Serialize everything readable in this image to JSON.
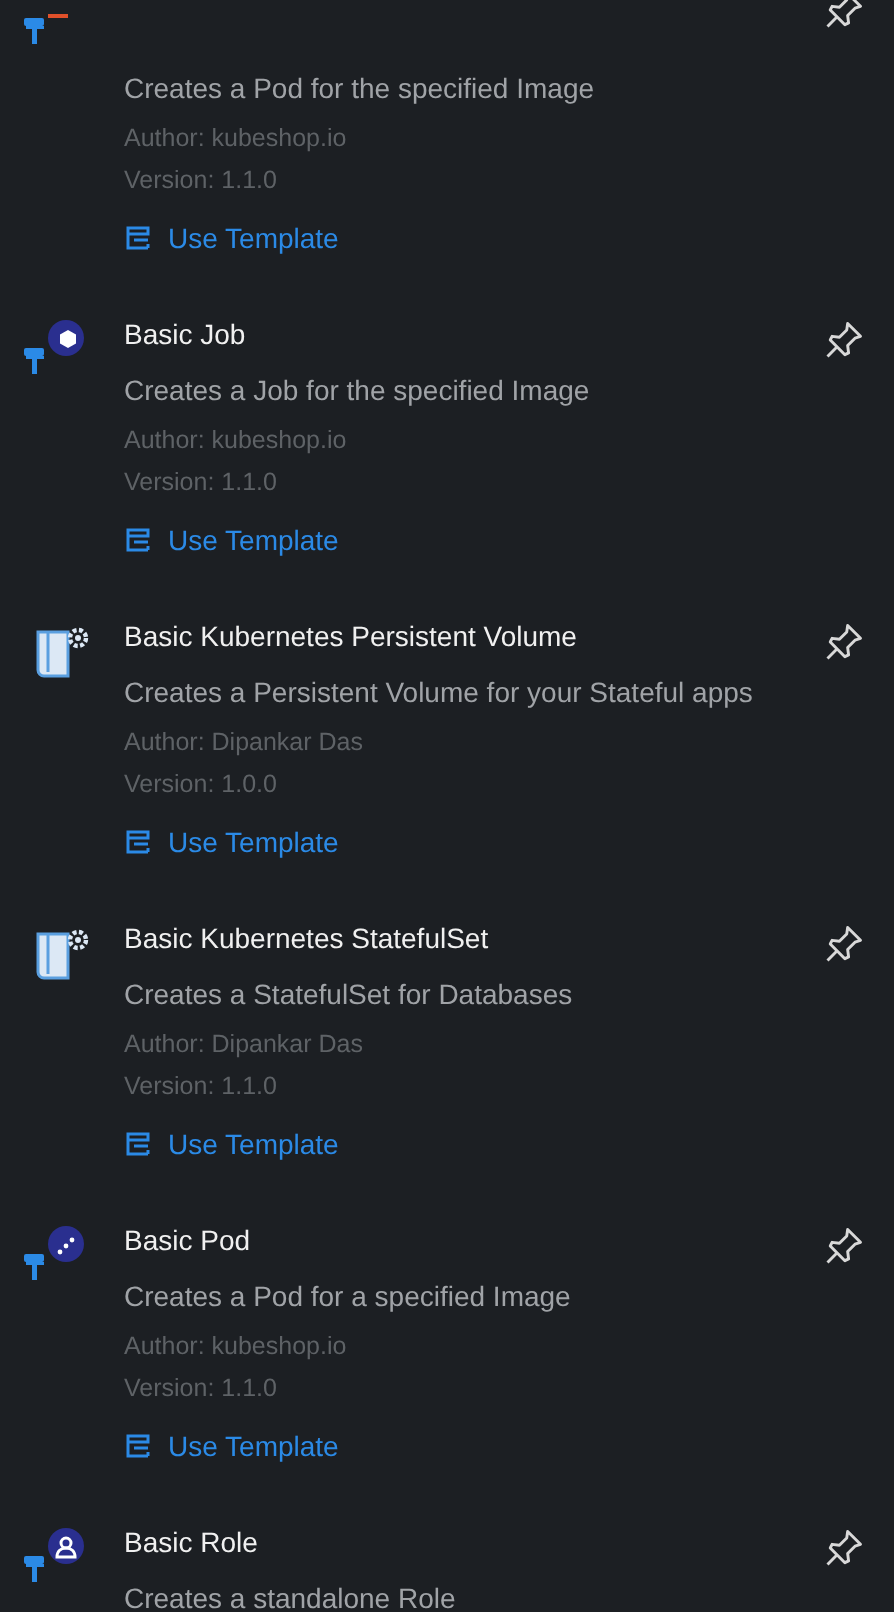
{
  "templates": [
    {
      "kind": "pod",
      "description": "Creates a Pod for the specified Image",
      "author": "Author: kubeshop.io",
      "version": "Version: 1.1.0",
      "action": "Use Template"
    },
    {
      "kind": "job",
      "title": "Basic Job",
      "description": "Creates a Job for the specified Image",
      "author": "Author: kubeshop.io",
      "version": "Version: 1.1.0",
      "action": "Use Template"
    },
    {
      "kind": "volume",
      "title": "Basic Kubernetes Persistent Volume",
      "description": "Creates a Persistent Volume for your Stateful apps",
      "author": "Author: Dipankar Das",
      "version": "Version: 1.0.0",
      "action": "Use Template"
    },
    {
      "kind": "volume",
      "title": "Basic Kubernetes StatefulSet",
      "description": "Creates a StatefulSet for Databases",
      "author": "Author: Dipankar Das",
      "version": "Version: 1.1.0",
      "action": "Use Template"
    },
    {
      "kind": "pod",
      "title": "Basic Pod",
      "description": "Creates a Pod for a specified Image",
      "author": "Author: kubeshop.io",
      "version": "Version: 1.1.0",
      "action": "Use Template"
    },
    {
      "kind": "role",
      "title": "Basic Role",
      "description": "Creates a standalone Role"
    }
  ]
}
